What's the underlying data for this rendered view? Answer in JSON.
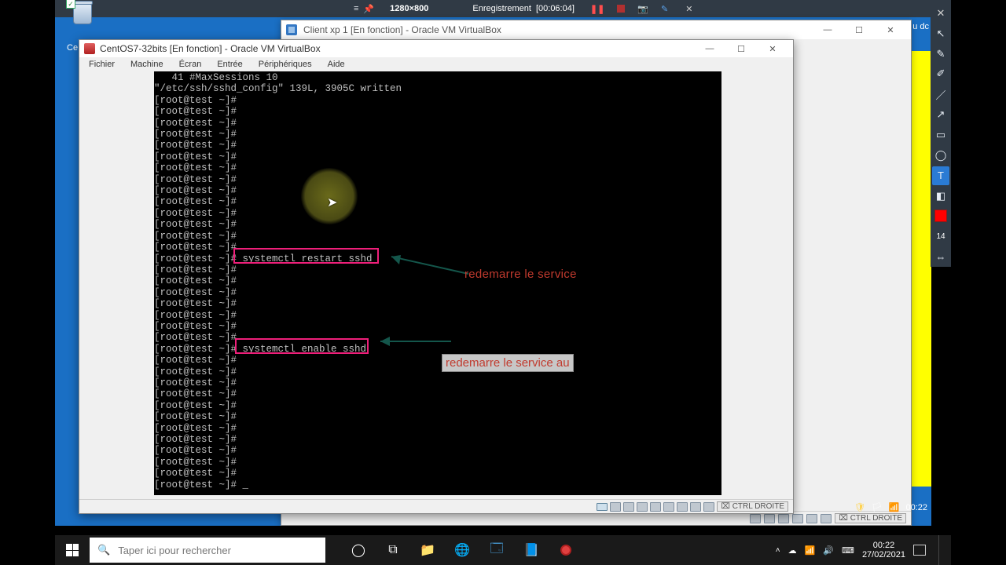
{
  "recbar": {
    "resolution": "1280×800",
    "label": "Enregistrement",
    "time": "[00:06:04]"
  },
  "desktop": {
    "left_partial_label": "Ce",
    "right_partial_label": "u dc"
  },
  "vbx_behind": {
    "title": "Client xp 1 [En fonction] - Oracle VM VirtualBox",
    "ctrl_key": "CTRL DROITE"
  },
  "vbx_front": {
    "title": "CentOS7-32bits [En fonction] - Oracle VM VirtualBox",
    "menus": {
      "file": "Fichier",
      "machine": "Machine",
      "screen": "Écran",
      "input": "Entrée",
      "devices": "Périphériques",
      "help": "Aide"
    },
    "ctrl_key": "CTRL DROITE"
  },
  "terminal": {
    "line_top1": "   41 #MaxSessions 10",
    "line_top2": "\"/etc/ssh/sshd_config\" 139L, 3905C written",
    "prompt": "[root@test ~]#",
    "cmd1": "systemctl restart sshd",
    "cmd2": "systemctl enable sshd",
    "last_prompt": "[root@test ~]# _"
  },
  "annotations": {
    "text1": "redemarre le service",
    "text2": "redemarre le service au "
  },
  "sidetool": {
    "num": "14"
  },
  "taskbar": {
    "search_placeholder": "Taper ici pour rechercher",
    "time": "00:22",
    "date": "27/02/2021"
  },
  "tray_time_in_yellow": "00:22"
}
